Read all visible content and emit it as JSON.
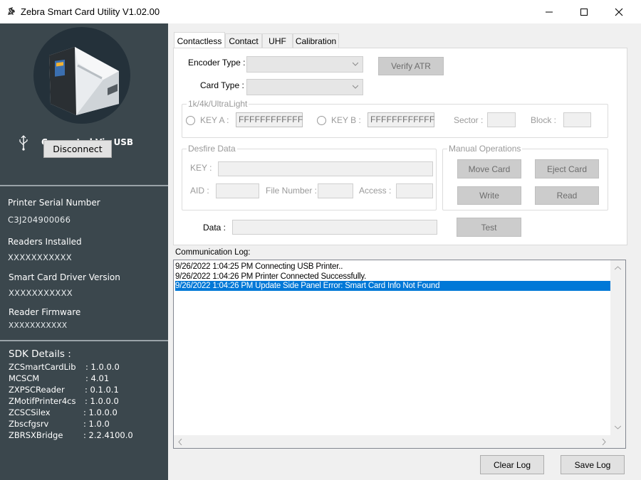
{
  "window": {
    "title": "Zebra Smart Card Utility  V1.02.00",
    "icon": "zebra-logo-icon",
    "controls": [
      "minimize-icon",
      "maximize-icon",
      "close-icon"
    ]
  },
  "sidebar": {
    "connection_label": "Connected Via USB",
    "connection_icon": "usb-icon",
    "disconnect_label": "Disconnect",
    "printer_serial_label": "Printer Serial Number",
    "printer_serial_value": "C3J204900066",
    "readers_label": "Readers Installed",
    "readers_value": "XXXXXXXXXXX",
    "driver_label": "Smart Card Driver Version",
    "driver_value": "XXXXXXXXXXX",
    "firmware_label": "Reader Firmware",
    "firmware_value": "XXXXXXXXXXX",
    "sdk_title": "SDK Details :",
    "sdk": [
      {
        "name": "ZCSmartCardLib",
        "value": ": 1.0.0.0"
      },
      {
        "name": "MCSCM",
        "value": ": 4.01"
      },
      {
        "name": "ZXPSCReader",
        "value": ": 0.1.0.1"
      },
      {
        "name": "ZMotifPrinter4cs",
        "value": ": 1.0.0.0"
      },
      {
        "name": "ZCSCSilex",
        "value": ": 1.0.0.0"
      },
      {
        "name": "Zbscfgsrv",
        "value": ": 1.0.0"
      },
      {
        "name": "ZBRSXBridge",
        "value": ": 2.2.4100.0"
      }
    ],
    "colors": {
      "background": "#3b474d",
      "circle": "#24313a"
    }
  },
  "tabs": [
    {
      "label": "Contactless",
      "active": true
    },
    {
      "label": "Contact",
      "active": false
    },
    {
      "label": "UHF",
      "active": false
    },
    {
      "label": "Calibration",
      "active": false
    }
  ],
  "contactless": {
    "encoder_type_label": "Encoder Type :",
    "encoder_type_value": "",
    "card_type_label": "Card Type :",
    "card_type_value": "",
    "verify_atr_label": "Verify ATR",
    "ultralight_group_title": "1k/4k/UltraLight",
    "key_a_label": "KEY A :",
    "key_a_value": "FFFFFFFFFFFF",
    "key_b_label": "KEY B :",
    "key_b_value": "FFFFFFFFFFFF",
    "sector_label": "Sector :",
    "block_label": "Block :",
    "desfire_group_title": "Desfire Data",
    "desfire_key_label": "KEY :",
    "aid_label": "AID :",
    "file_number_label": "File Number :",
    "access_label": "Access :",
    "manual_ops_title": "Manual Operations",
    "move_card_label": "Move Card",
    "eject_card_label": "Eject Card",
    "write_label": "Write",
    "read_label": "Read",
    "data_label": "Data :",
    "test_label": "Test"
  },
  "log": {
    "label": "Communication Log:",
    "lines": [
      {
        "text": "9/26/2022 1:04:25 PM Connecting USB Printer..",
        "selected": false
      },
      {
        "text": "9/26/2022 1:04:26 PM Printer Connected Successfully.",
        "selected": false
      },
      {
        "text": "9/26/2022 1:04:26 PM Update Side Panel Error: Smart Card Info Not Found",
        "selected": true
      }
    ],
    "clear_label": "Clear Log",
    "save_label": "Save Log",
    "selection_color": "#0078d7"
  }
}
